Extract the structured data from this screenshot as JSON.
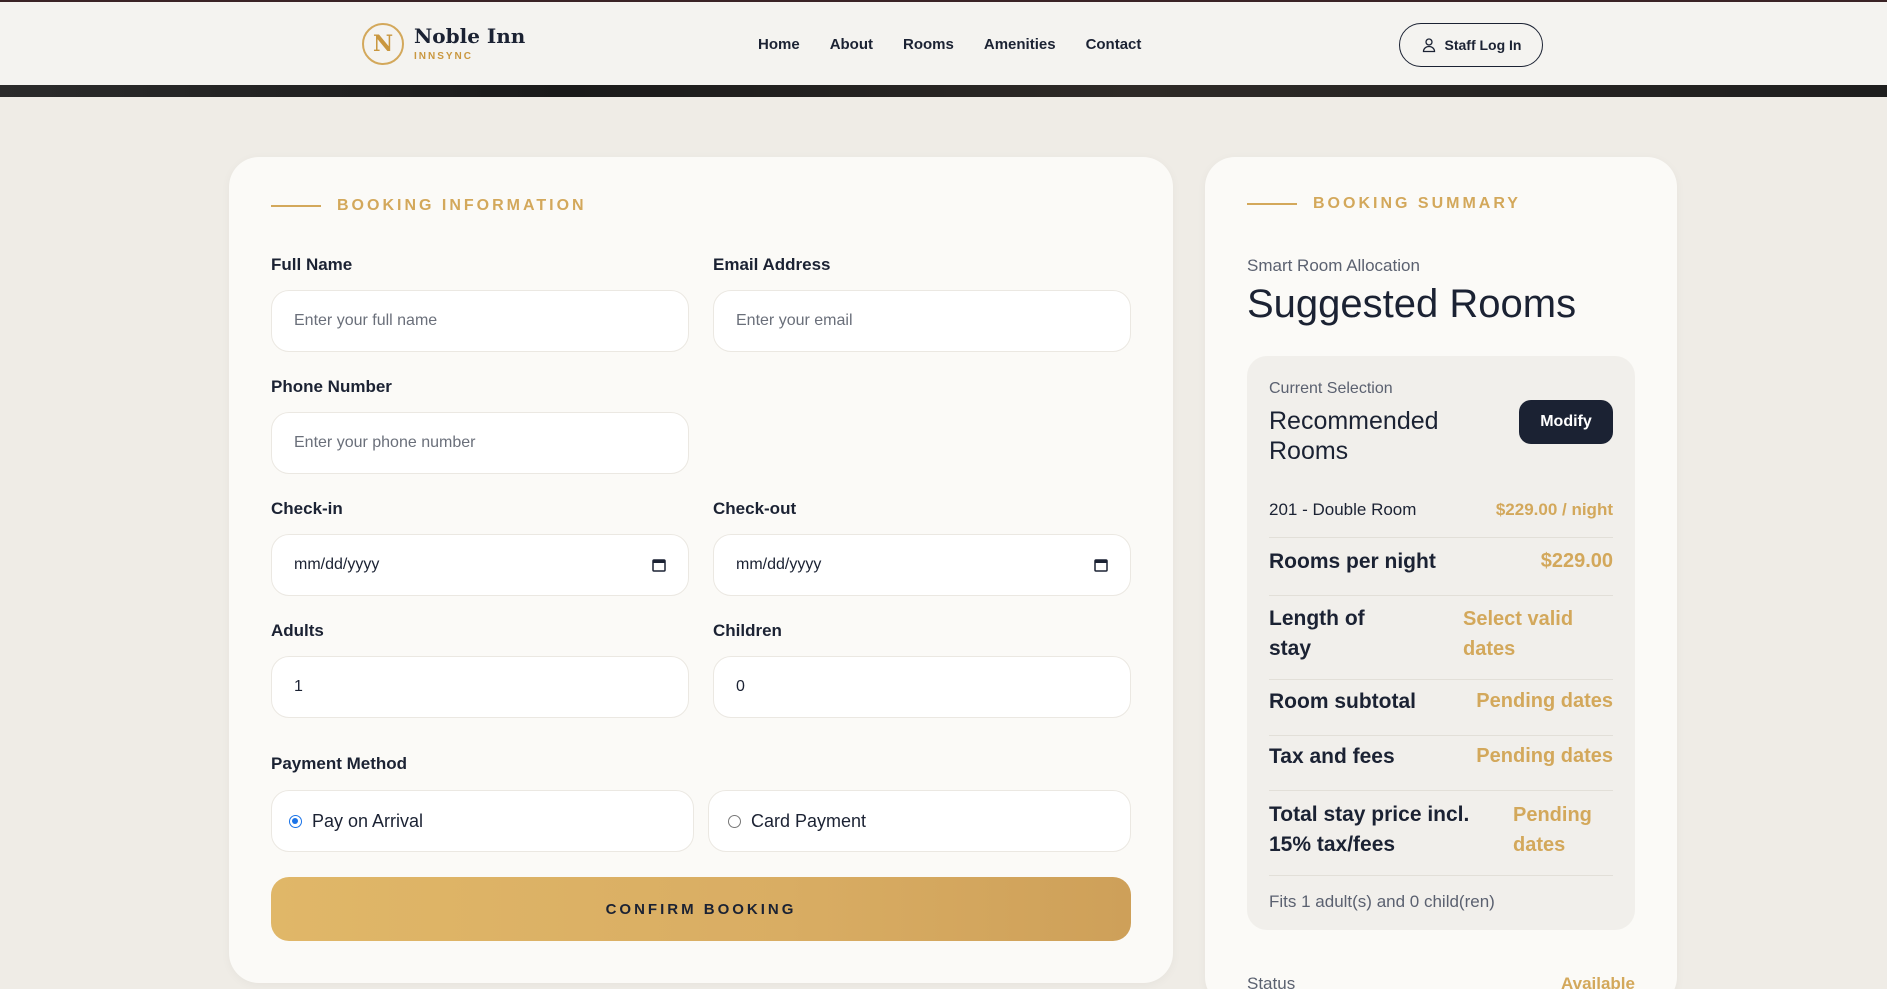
{
  "brand": {
    "initial": "N",
    "name": "Noble Inn",
    "subtitle": "INNSYNC"
  },
  "nav": {
    "items": [
      "Home",
      "About",
      "Rooms",
      "Amenities",
      "Contact"
    ],
    "staff_login": "Staff Log In"
  },
  "booking": {
    "section_title": "BOOKING INFORMATION",
    "full_name": {
      "label": "Full Name",
      "placeholder": "Enter your full name"
    },
    "email": {
      "label": "Email Address",
      "placeholder": "Enter your email"
    },
    "phone": {
      "label": "Phone Number",
      "placeholder": "Enter your phone number"
    },
    "checkin": {
      "label": "Check-in",
      "value": "mm/dd/yyyy"
    },
    "checkout": {
      "label": "Check-out",
      "value": "mm/dd/yyyy"
    },
    "adults": {
      "label": "Adults",
      "value": "1"
    },
    "children": {
      "label": "Children",
      "value": "0"
    },
    "payment": {
      "label": "Payment Method",
      "options": [
        "Pay on Arrival",
        "Card Payment"
      ],
      "selected": "Pay on Arrival"
    },
    "confirm": "CONFIRM BOOKING"
  },
  "summary": {
    "section_title": "BOOKING SUMMARY",
    "smart_label": "Smart Room Allocation",
    "title": "Suggested Rooms",
    "selection": {
      "small_label": "Current Selection",
      "title": "Recommended Rooms",
      "modify": "Modify",
      "room_line": {
        "key": "201 - Double Room",
        "value": "$229.00 / night"
      },
      "rows": [
        {
          "key": "Rooms per night",
          "value": "$229.00"
        },
        {
          "key": "Length of stay",
          "value": "Select valid dates"
        },
        {
          "key": "Room subtotal",
          "value": "Pending dates"
        },
        {
          "key": "Tax and fees",
          "value": "Pending dates"
        },
        {
          "key": "Total stay price incl. 15% tax/fees",
          "value": "Pending dates"
        }
      ],
      "fits": "Fits 1 adult(s) and 0 child(ren)"
    },
    "status": {
      "key": "Status",
      "value": "Available"
    }
  },
  "colors": {
    "accent": "#d3a85b",
    "navy": "#1b2233",
    "background": "#efece6",
    "radio_selected": "#1a73e8"
  }
}
